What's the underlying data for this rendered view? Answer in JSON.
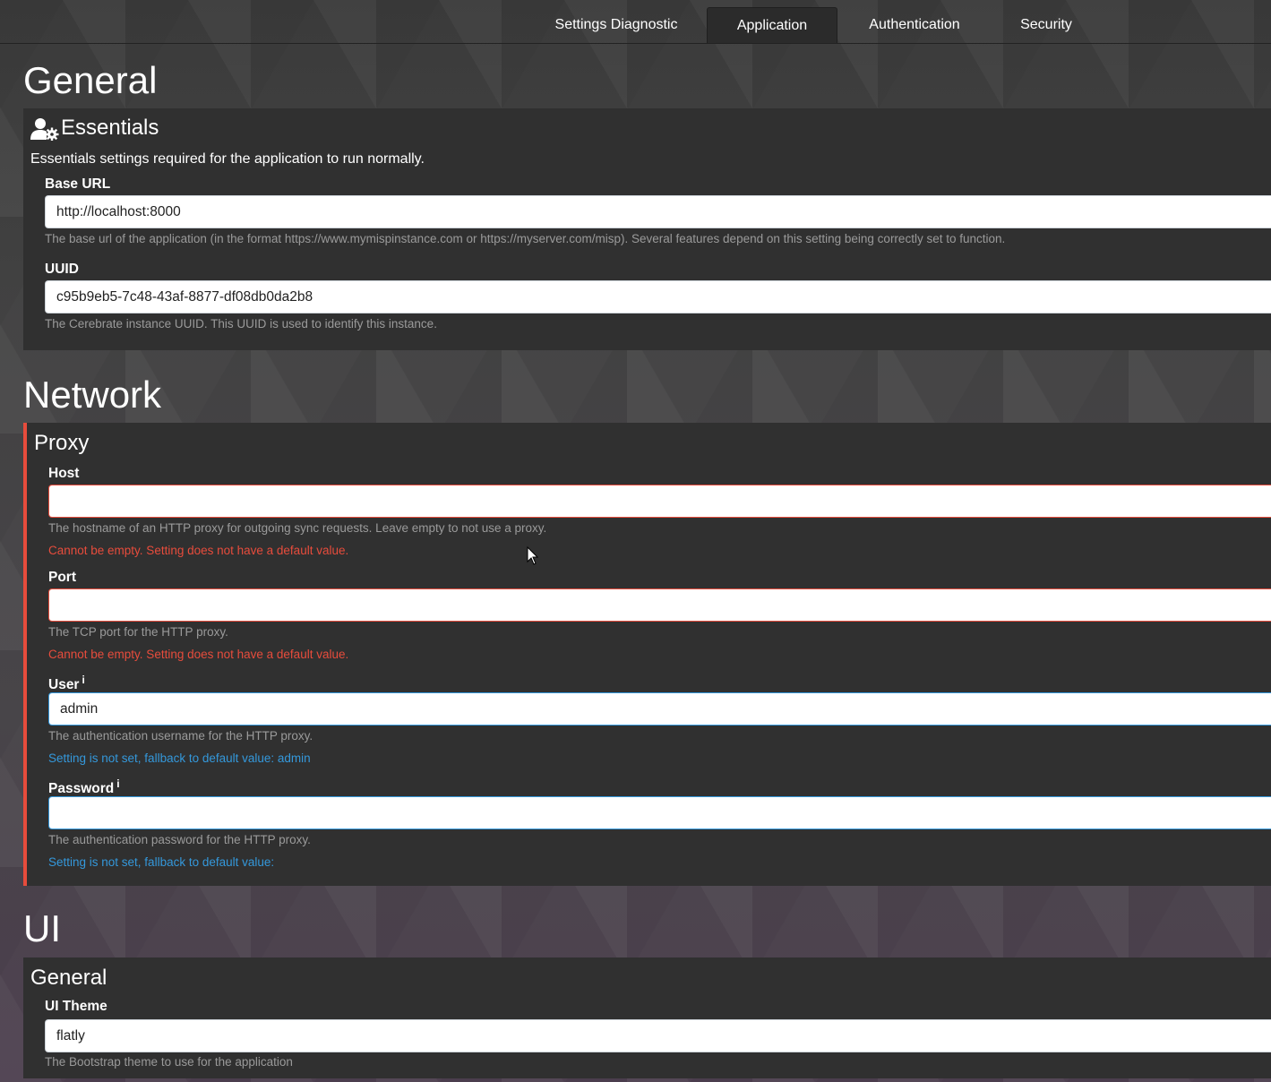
{
  "tabs": [
    {
      "label": "Settings Diagnostic"
    },
    {
      "label": "Application",
      "active": true
    },
    {
      "label": "Authentication"
    },
    {
      "label": "Security"
    }
  ],
  "sections": {
    "general": {
      "title": "General",
      "essentials": {
        "title": "Essentials",
        "icon": "user-gear-icon",
        "description": "Essentials settings required for the application to run normally.",
        "base_url": {
          "label": "Base URL",
          "value": "http://localhost:8000",
          "help": "The base url of the application (in the format https://www.mymispinstance.com or https://myserver.com/misp). Several features depend on this setting being correctly set to function."
        },
        "uuid": {
          "label": "UUID",
          "value": "c95b9eb5-7c48-43af-8877-df08db0da2b8",
          "help": "The Cerebrate instance UUID. This UUID is used to identify this instance."
        }
      }
    },
    "network": {
      "title": "Network",
      "proxy": {
        "title": "Proxy",
        "host": {
          "label": "Host",
          "value": "",
          "help": "The hostname of an HTTP proxy for outgoing sync requests. Leave empty to not use a proxy.",
          "error": "Cannot be empty. Setting does not have a default value."
        },
        "port": {
          "label": "Port",
          "value": "",
          "help": "The TCP port for the HTTP proxy.",
          "error": "Cannot be empty. Setting does not have a default value."
        },
        "user": {
          "label": "User",
          "info_icon": "i",
          "value": "admin",
          "help": "The authentication username for the HTTP proxy.",
          "notice": "Setting is not set, fallback to default value: admin"
        },
        "password": {
          "label": "Password",
          "info_icon": "i",
          "value": "",
          "help": "The authentication password for the HTTP proxy.",
          "notice": "Setting is not set, fallback to default value:"
        }
      }
    },
    "ui": {
      "title": "UI",
      "general": {
        "title": "General",
        "theme": {
          "label": "UI Theme",
          "value": "flatly",
          "help": "The Bootstrap theme to use for the application"
        }
      }
    }
  },
  "colors": {
    "error": "#e74c3c",
    "info": "#3498db",
    "card": "#303030"
  }
}
